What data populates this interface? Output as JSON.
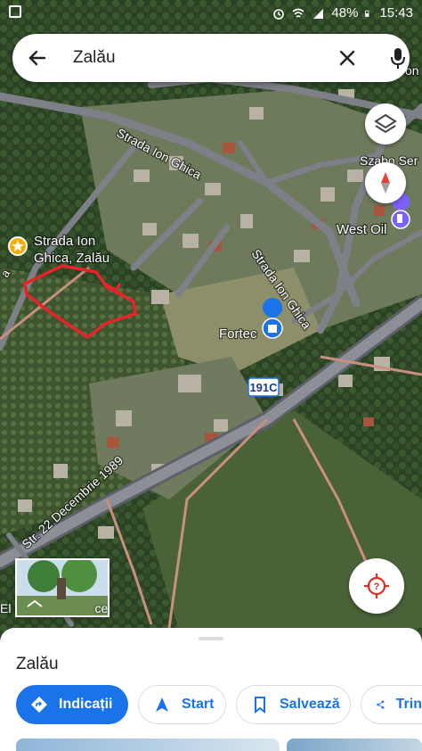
{
  "status_bar": {
    "battery": "48%",
    "time": "15:43"
  },
  "search": {
    "query": "Zalău"
  },
  "map": {
    "streets": [
      {
        "name": "Strada Ion Ghica"
      },
      {
        "name": "Strada Ion Ghica"
      },
      {
        "name": "Str. 22 Decembrie 1989"
      }
    ],
    "places": [
      {
        "name": "West Oil",
        "icon": "gas-station-icon"
      },
      {
        "name": "Fortec",
        "icon": "shopping-bag-icon"
      },
      {
        "name": "Szabo Ser",
        "icon": ""
      },
      {
        "name": "on",
        "icon": ""
      }
    ],
    "pinned_place": {
      "line1": "Strada Ion",
      "line2": "Ghica, Zalău",
      "icon": "star-pin-icon"
    },
    "road_shield": "191C",
    "edge_labels": {
      "left": "a"
    },
    "drawn_annotation": {
      "color": "#e8232a"
    }
  },
  "streetview": {
    "caption_left": "El",
    "caption_right": "ce"
  },
  "place_sheet": {
    "title": "Zalău",
    "actions": [
      {
        "label": "Indicații",
        "icon": "directions-icon"
      },
      {
        "label": "Start",
        "icon": "navigation-arrow-icon"
      },
      {
        "label": "Salvează",
        "icon": "bookmark-icon"
      },
      {
        "label": "Trin",
        "icon": "share-icon"
      }
    ]
  },
  "colors": {
    "accent": "#1a73e8",
    "compass_red": "#ea4335",
    "star_pin": "#f9ab00",
    "locate_red": "#d93025"
  }
}
